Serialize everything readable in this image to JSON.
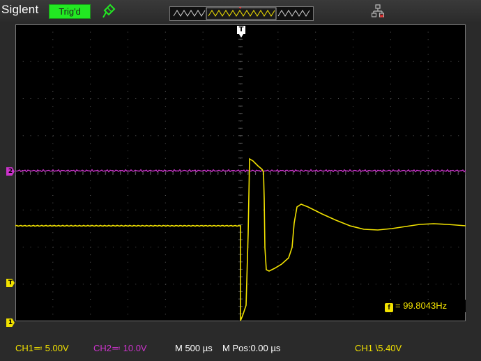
{
  "header": {
    "brand": "Siglent",
    "trigger_status": "Trig'd",
    "trigger_status_color": "#22e822"
  },
  "icons": {
    "probe": "probe-icon",
    "network": "network-icon",
    "trigger_position": "trigger-position-icon"
  },
  "markers": {
    "trigger_position": "T",
    "ch2_level": "2",
    "trigger_level": "T",
    "ch1_level": "1"
  },
  "measurement": {
    "frequency_badge": "f",
    "frequency": "= 99.8043Hz"
  },
  "footer": {
    "ch1_scale": "CH1≕ 5.00V",
    "ch2_scale": "CH2≕ 10.0V",
    "timebase": "M 500 µs",
    "mpos": "M Pos:0.00 µs",
    "trigger_info": "CH1 \\5.40V"
  },
  "colors": {
    "ch1": "#f2e200",
    "ch2": "#cc33cc",
    "grid": "#5a5a5a"
  }
}
